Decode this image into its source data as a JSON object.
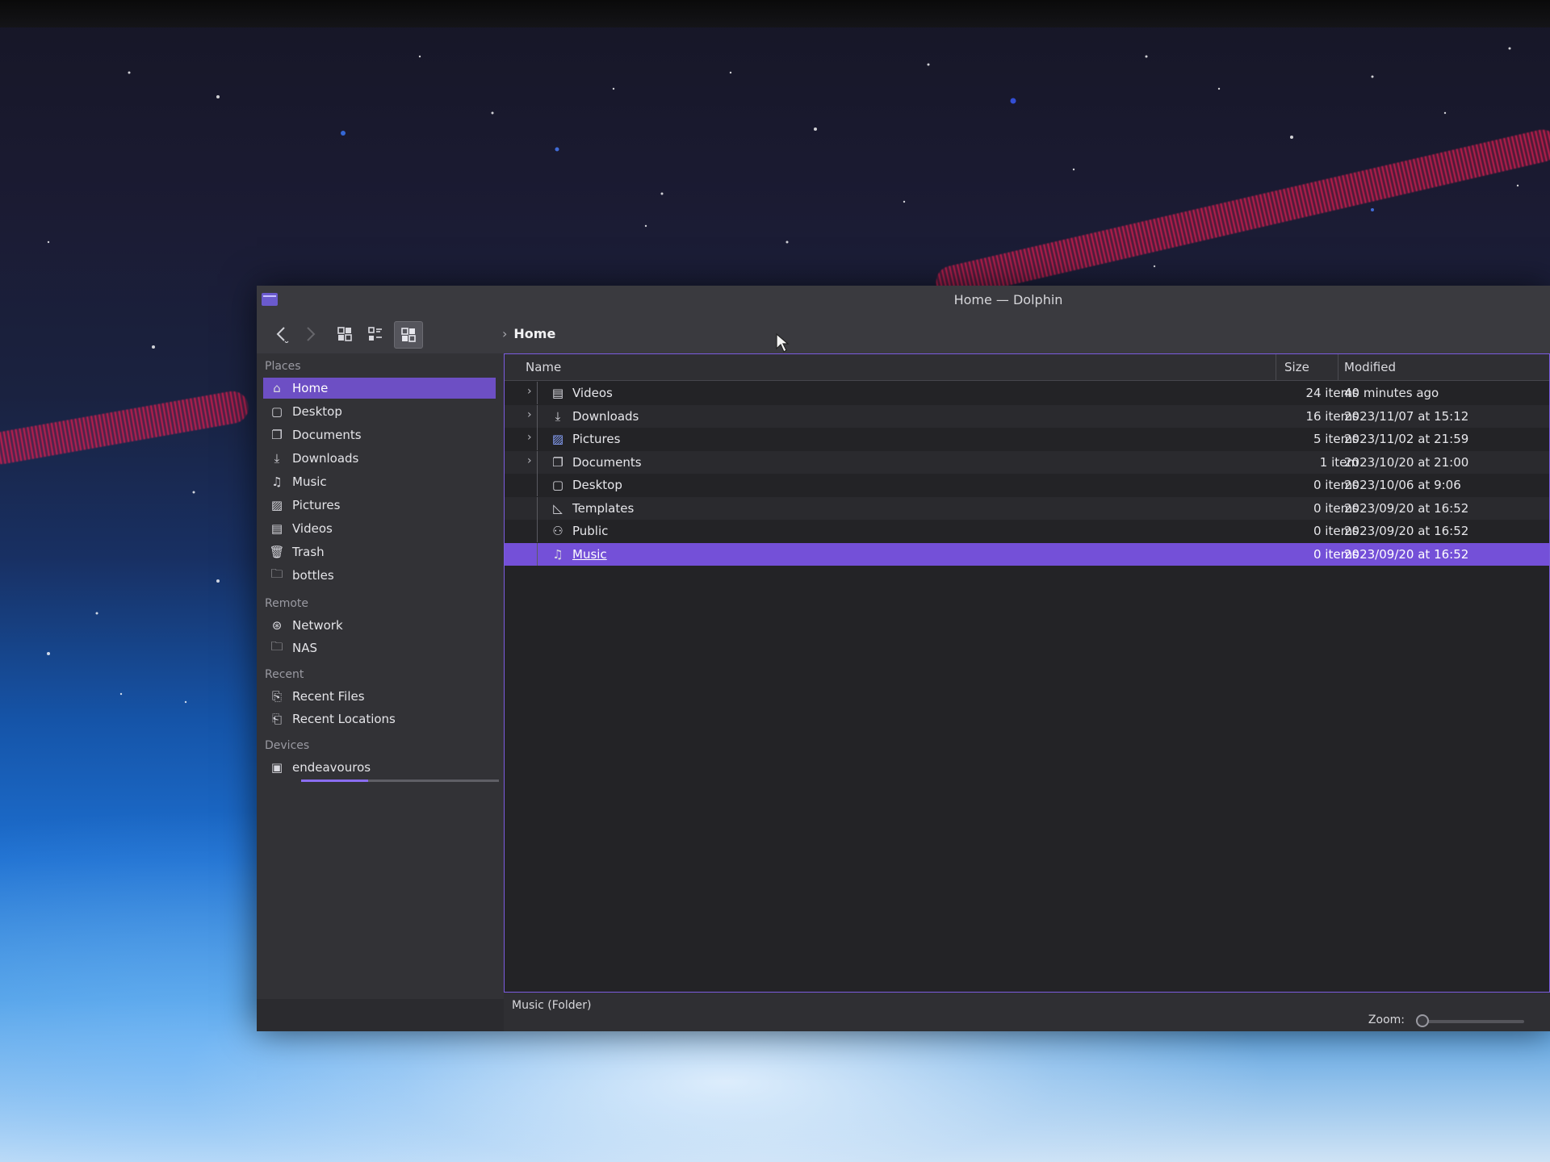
{
  "window": {
    "title": "Home — Dolphin"
  },
  "toolbar": {
    "back_icon": "back-arrow-icon",
    "forward_icon": "forward-arrow-icon",
    "view_modes": [
      "icons-view-icon",
      "compact-view-icon",
      "details-view-icon"
    ],
    "active_view": "details"
  },
  "breadcrumb": {
    "items": [
      "Home"
    ]
  },
  "places": {
    "sections": [
      {
        "title": "Places",
        "items": [
          {
            "label": "Home",
            "icon": "home-icon",
            "selected": true
          },
          {
            "label": "Desktop",
            "icon": "desktop-icon"
          },
          {
            "label": "Documents",
            "icon": "documents-icon"
          },
          {
            "label": "Downloads",
            "icon": "downloads-icon"
          },
          {
            "label": "Music",
            "icon": "music-icon"
          },
          {
            "label": "Pictures",
            "icon": "pictures-icon"
          },
          {
            "label": "Videos",
            "icon": "videos-icon"
          },
          {
            "label": "Trash",
            "icon": "trash-icon"
          },
          {
            "label": "bottles",
            "icon": "folder-icon"
          }
        ]
      },
      {
        "title": "Remote",
        "items": [
          {
            "label": "Network",
            "icon": "network-icon"
          },
          {
            "label": "NAS",
            "icon": "folder-icon"
          }
        ]
      },
      {
        "title": "Recent",
        "items": [
          {
            "label": "Recent Files",
            "icon": "recent-files-icon"
          },
          {
            "label": "Recent Locations",
            "icon": "recent-locations-icon"
          }
        ]
      },
      {
        "title": "Devices",
        "items": [
          {
            "label": "endeavouros",
            "icon": "drive-icon",
            "usage_fraction": 0.34
          }
        ]
      }
    ]
  },
  "columns": {
    "name": "Name",
    "size": "Size",
    "modified": "Modified"
  },
  "files": [
    {
      "name": "Videos",
      "icon": "videos-icon",
      "size": "24 items",
      "modified": "40 minutes ago",
      "expandable": true
    },
    {
      "name": "Downloads",
      "icon": "downloads-icon",
      "size": "16 items",
      "modified": "2023/11/07 at 15:12",
      "expandable": true
    },
    {
      "name": "Pictures",
      "icon": "pictures-icon",
      "size": "5 items",
      "modified": "2023/11/02 at 21:59",
      "expandable": true
    },
    {
      "name": "Documents",
      "icon": "documents-icon",
      "size": "1 item",
      "modified": "2023/10/20 at 21:00",
      "expandable": true
    },
    {
      "name": "Desktop",
      "icon": "desktop-icon",
      "size": "0 items",
      "modified": "2023/10/06 at 9:06",
      "expandable": false
    },
    {
      "name": "Templates",
      "icon": "templates-icon",
      "size": "0 items",
      "modified": "2023/09/20 at 16:52",
      "expandable": false
    },
    {
      "name": "Public",
      "icon": "public-icon",
      "size": "0 items",
      "modified": "2023/09/20 at 16:52",
      "expandable": false
    },
    {
      "name": "Music",
      "icon": "music-icon",
      "size": "0 items",
      "modified": "2023/09/20 at 16:52",
      "expandable": false,
      "selected": true
    }
  ],
  "status": {
    "text": "Music (Folder)",
    "zoom_label": "Zoom:",
    "zoom_level_fraction": 0.0
  },
  "colors": {
    "accent": "#7450d8",
    "window_bg": "#2b2b2f",
    "view_bg": "#232326"
  }
}
